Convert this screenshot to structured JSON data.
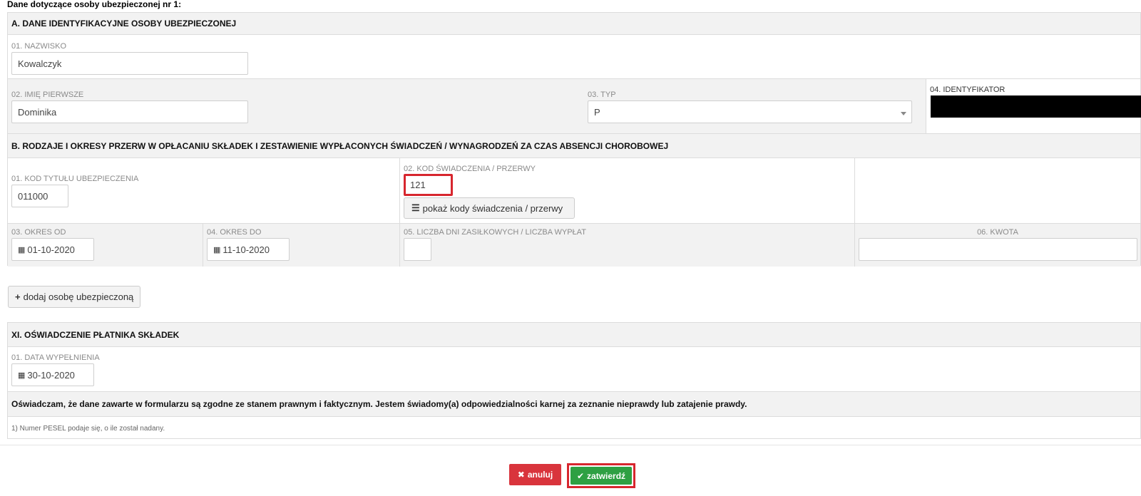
{
  "heading": "Dane dotyczące osoby ubezpieczonej nr 1:",
  "section_a": {
    "title": "A. DANE IDENTYFIKACYJNE OSOBY UBEZPIECZONEJ",
    "surname_label": "01. NAZWISKO",
    "surname_value": "Kowalczyk",
    "firstname_label": "02. IMIĘ PIERWSZE",
    "firstname_value": "Dominika",
    "type_label": "03. TYP",
    "type_value": "P",
    "identifier_label": "04. IDENTYFIKATOR"
  },
  "section_b": {
    "title": "B. RODZAJE I OKRESY PRZERW W OPŁACANIU SKŁADEK I ZESTAWIENIE WYPŁACONYCH ŚWIADCZEŃ / WYNAGRODZEŃ ZA CZAS ABSENCJI CHOROBOWEJ",
    "insurance_code_label": "01. KOD TYTUŁU UBEZPIECZENIA",
    "insurance_code_value": "011000",
    "benefit_code_label": "02. KOD ŚWIADCZENIA / PRZERWY",
    "benefit_code_value": "121",
    "show_codes_label": "pokaż kody świadczenia / przerwy",
    "period_from_label": "03. OKRES OD",
    "period_from_value": "01-10-2020",
    "period_to_label": "04. OKRES DO",
    "period_to_value": "11-10-2020",
    "days_label": "05. LICZBA DNI ZASIŁKOWYCH / LICZBA WYPŁAT",
    "days_value": "",
    "amount_label": "06. KWOTA",
    "amount_value": ""
  },
  "add_person_label": "dodaj osobę ubezpieczoną",
  "section_xi": {
    "title": "XI. OŚWIADCZENIE PŁATNIKA SKŁADEK",
    "date_label": "01. DATA WYPEŁNIENIA",
    "date_value": "30-10-2020",
    "declaration": "Oświadczam, że dane zawarte w formularzu są zgodne ze stanem prawnym i faktycznym. Jestem świadomy(a) odpowiedzialności karnej za zeznanie nieprawdy lub zatajenie prawdy.",
    "footnote": "1) Numer PESEL podaje się, o ile został nadany."
  },
  "actions": {
    "cancel_label": "anuluj",
    "confirm_label": "zatwierdź"
  },
  "icons": {
    "calendar": "calendar-icon",
    "list": "list-icon",
    "plus": "plus-icon",
    "times": "times-icon",
    "check": "check-icon"
  },
  "colors": {
    "highlight": "#d7262e",
    "cancel": "#d9343c",
    "confirm": "#2ea043"
  }
}
